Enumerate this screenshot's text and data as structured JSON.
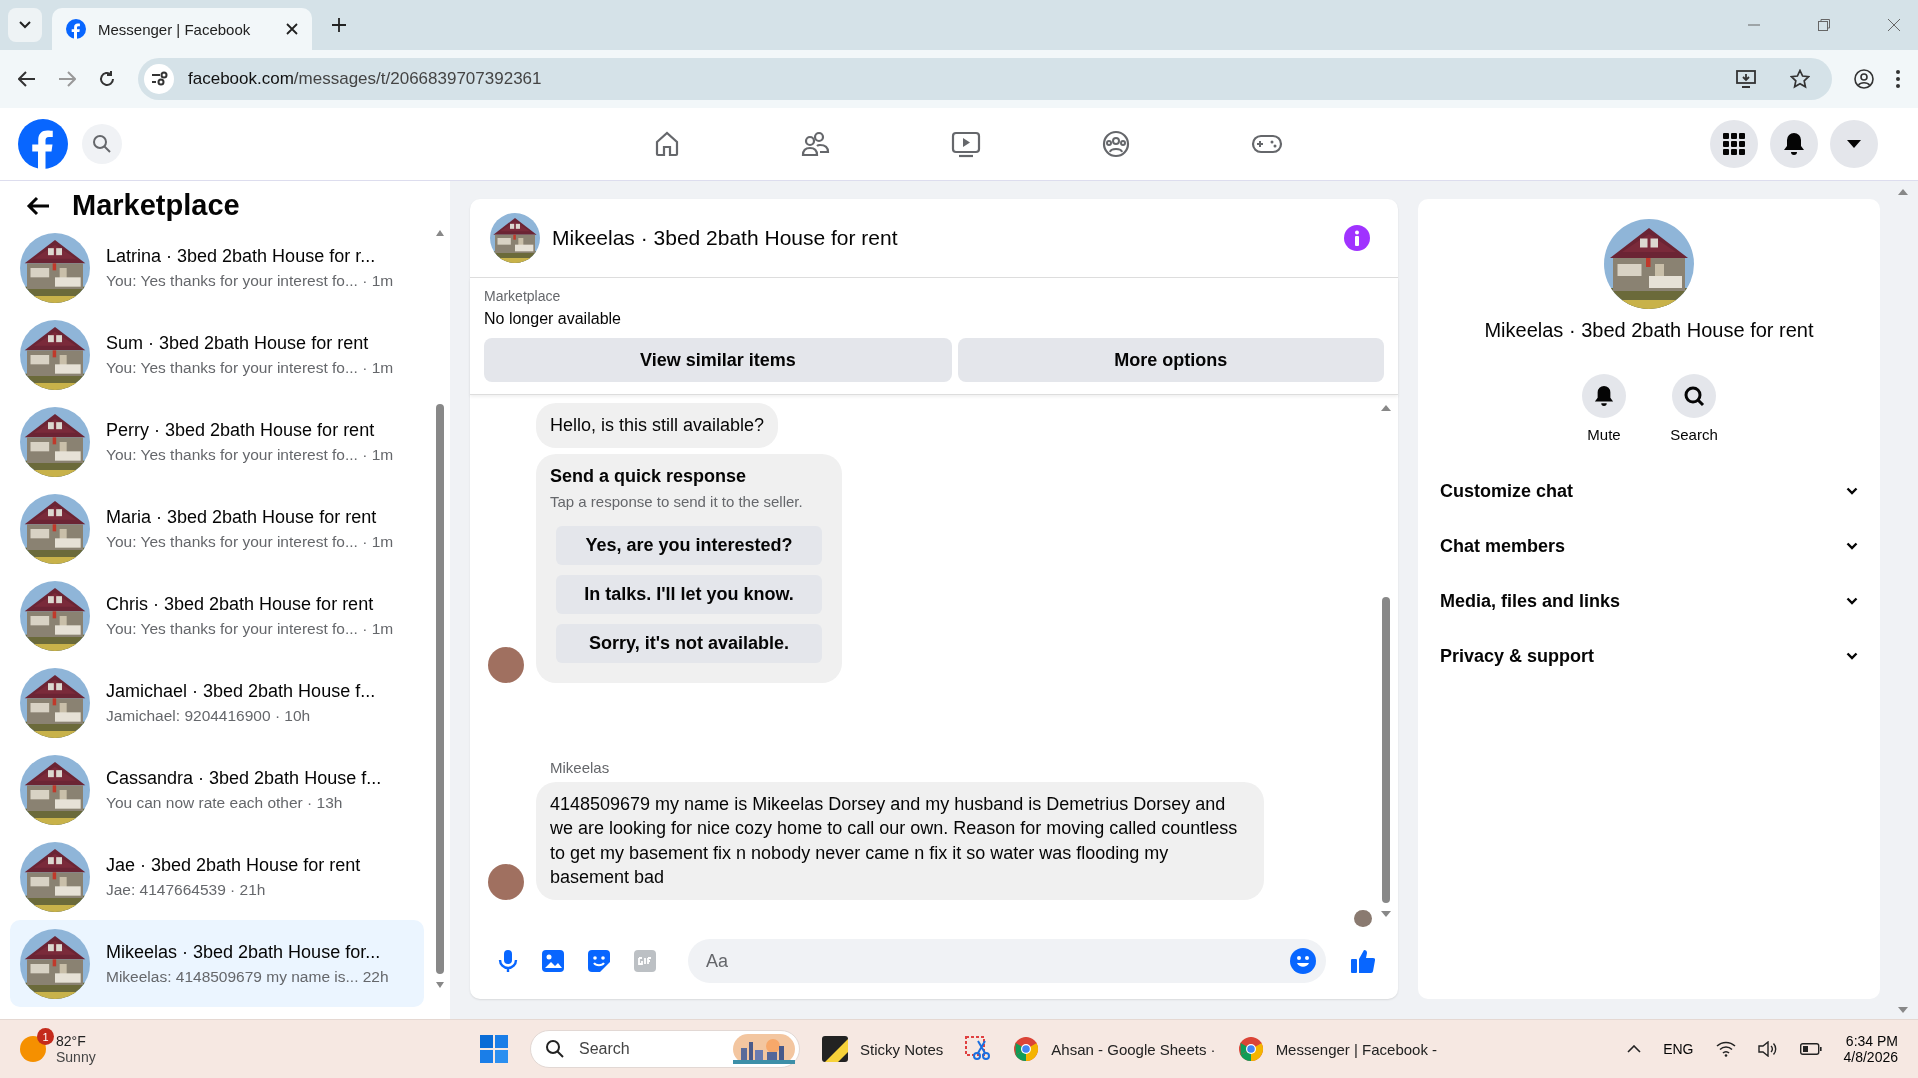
{
  "browser": {
    "tab_title": "Messenger | Facebook",
    "url_host": "facebook.com",
    "url_path": "/messages/t/2066839707392361"
  },
  "left_panel": {
    "title": "Marketplace",
    "conversations": [
      {
        "title": "Latrina · 3bed 2bath House for r...",
        "snippet": "You: Yes thanks for your interest fo... · 1m",
        "selected": false
      },
      {
        "title": "Sum · 3bed 2bath House for rent",
        "snippet": "You: Yes thanks for your interest fo... · 1m",
        "selected": false
      },
      {
        "title": "Perry · 3bed 2bath House for rent",
        "snippet": "You: Yes thanks for your interest fo... · 1m",
        "selected": false
      },
      {
        "title": "Maria · 3bed 2bath House for rent",
        "snippet": "You: Yes thanks for your interest fo... · 1m",
        "selected": false
      },
      {
        "title": "Chris · 3bed 2bath House for rent",
        "snippet": "You: Yes thanks for your interest fo... · 1m",
        "selected": false
      },
      {
        "title": "Jamichael · 3bed 2bath House f...",
        "snippet": "Jamichael: 9204416900 · 10h",
        "selected": false
      },
      {
        "title": "Cassandra · 3bed 2bath House f...",
        "snippet": "You can now rate each other · 13h",
        "selected": false
      },
      {
        "title": "Jae · 3bed 2bath House for rent",
        "snippet": "Jae: 4147664539 · 21h",
        "selected": false
      },
      {
        "title": "Mikeelas · 3bed 2bath House for...",
        "snippet": "Mikeelas: 4148509679 my name is...  22h",
        "selected": true
      }
    ]
  },
  "chat": {
    "title": "Mikeelas · 3bed 2bath House for rent",
    "listing_label": "Marketplace",
    "listing_status": "No longer available",
    "buttons": [
      "View similar items",
      "More options"
    ],
    "messages": [
      {
        "kind": "text",
        "text": "Hello, is this still available?"
      },
      {
        "kind": "quick",
        "title": "Send a quick response",
        "hint": "Tap a response to send it to the seller.",
        "options": [
          "Yes, are you interested?",
          "In talks. I'll let you know.",
          "Sorry, it's not available."
        ]
      },
      {
        "kind": "sender",
        "text": "Mikeelas"
      },
      {
        "kind": "text",
        "text": "4148509679 my name is Mikeelas Dorsey and my husband is Demetrius Dorsey and we are looking for nice cozy home to call our own. Reason for moving  called countless to get my basement fix n nobody never came n fix it so water was flooding my basement bad"
      }
    ],
    "composer_placeholder": "Aa"
  },
  "info_panel": {
    "title": "Mikeelas · 3bed 2bath House for rent",
    "actions": [
      {
        "kind": "bell",
        "label": "Mute"
      },
      {
        "kind": "search",
        "label": "Search"
      }
    ],
    "sections": [
      {
        "label": "Customize chat",
        "expanded": false
      },
      {
        "label": "Chat members",
        "expanded": false
      },
      {
        "label": "Media, files and links",
        "expanded": false
      },
      {
        "label": "Privacy & support",
        "expanded": false
      }
    ]
  },
  "taskbar": {
    "weather_badge": "1",
    "temperature": "82°F",
    "condition": "Sunny",
    "search_placeholder": "Search",
    "apps": [
      {
        "kind": "notes",
        "label": "Sticky Notes"
      },
      {
        "kind": "snip"
      },
      {
        "kind": "chrome",
        "label": "Ahsan - Google Sheets ·"
      },
      {
        "kind": "chrome",
        "label": "Messenger | Facebook -"
      }
    ],
    "language": "ENG",
    "time": "6:34 PM",
    "date": "4/8/2026"
  }
}
